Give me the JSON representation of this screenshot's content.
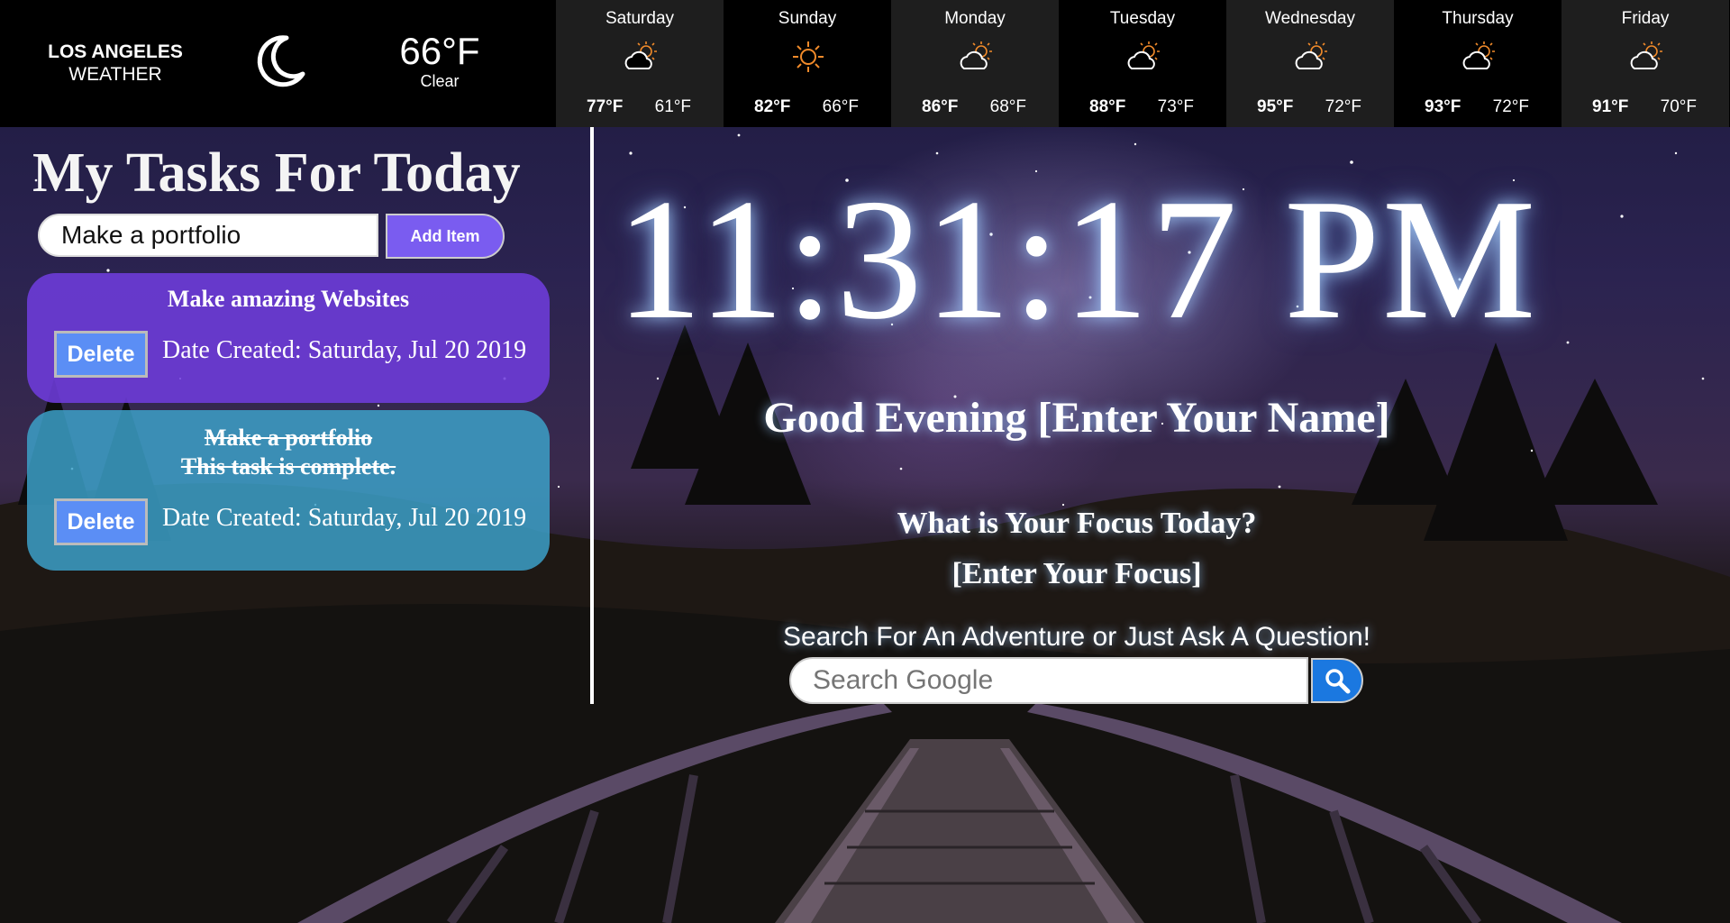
{
  "weather": {
    "city": "LOS ANGELES",
    "label": "WEATHER",
    "current_icon": "moon-icon",
    "current_temp": "66°F",
    "current_condition": "Clear",
    "forecast": [
      {
        "day": "Saturday",
        "icon": "partly-cloudy-icon",
        "high": "77°F",
        "low": "61°F"
      },
      {
        "day": "Sunday",
        "icon": "sun-icon",
        "high": "82°F",
        "low": "66°F"
      },
      {
        "day": "Monday",
        "icon": "partly-cloudy-icon",
        "high": "86°F",
        "low": "68°F"
      },
      {
        "day": "Tuesday",
        "icon": "partly-cloudy-icon",
        "high": "88°F",
        "low": "73°F"
      },
      {
        "day": "Wednesday",
        "icon": "partly-cloudy-icon",
        "high": "95°F",
        "low": "72°F"
      },
      {
        "day": "Thursday",
        "icon": "partly-cloudy-icon",
        "high": "93°F",
        "low": "72°F"
      },
      {
        "day": "Friday",
        "icon": "partly-cloudy-icon",
        "high": "91°F",
        "low": "70°F"
      }
    ]
  },
  "tasks": {
    "title": "My Tasks For Today",
    "input_value": "Make a portfolio",
    "add_label": "Add Item",
    "items": [
      {
        "title": "Make amazing Websites",
        "status": "",
        "delete_label": "Delete",
        "created": "Date Created: Saturday, Jul 20 2019",
        "color": "#6e3cdc"
      },
      {
        "title": "Make a portfolio",
        "status": "This task is complete.",
        "delete_label": "Delete",
        "created": "Date Created: Saturday, Jul 20 2019",
        "color": "#3ca0c8"
      }
    ]
  },
  "main": {
    "clock": "11:31:17 PM",
    "greeting": "Good Evening [Enter Your Name]",
    "focus_question": "What is Your Focus Today?",
    "focus_value": "[Enter Your Focus]",
    "search_label": "Search For An Adventure or Just Ask A Question!",
    "search_placeholder": "Search Google",
    "search_icon": "search-icon"
  },
  "colors": {
    "accent_purple": "#7a5cf0",
    "delete_blue": "#5b8ef5",
    "search_blue": "#1b78e0",
    "sun_orange": "#f08a2a"
  }
}
